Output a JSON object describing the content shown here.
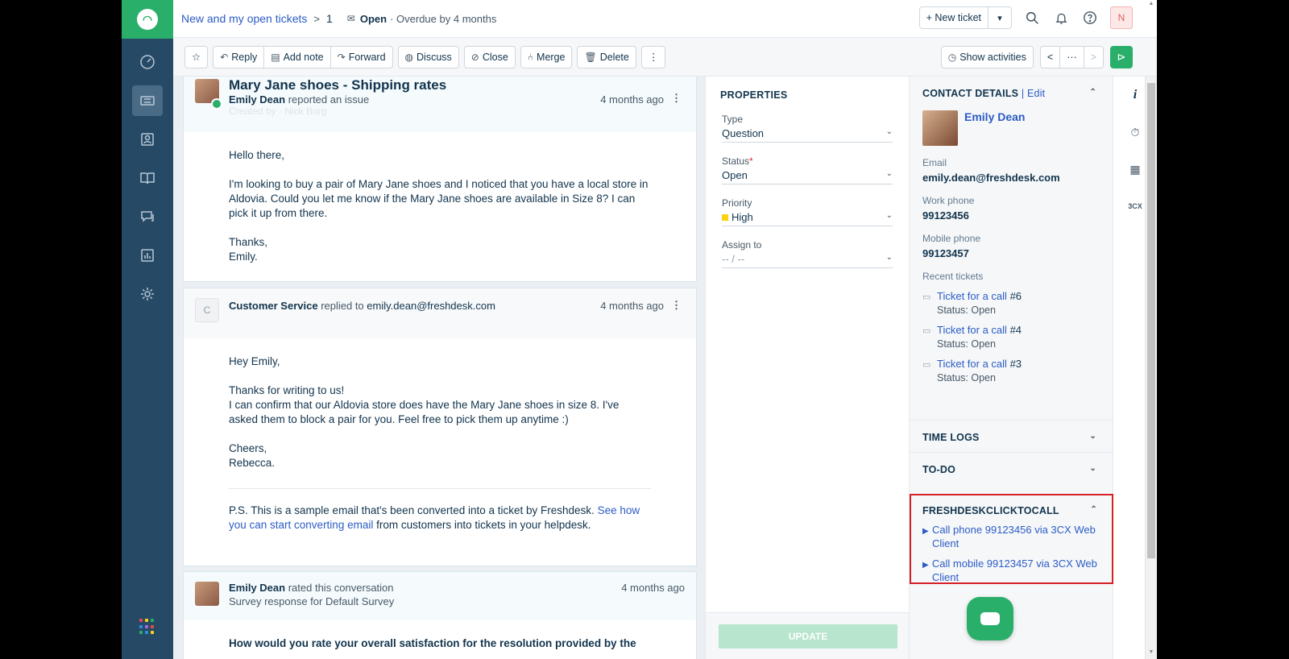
{
  "header": {
    "breadcrumb_link": "New and my open tickets",
    "breadcrumb_sep": ">",
    "ticket_number": "1",
    "status": "Open",
    "overdue": "· Overdue by 4 months",
    "new_ticket_label": "+ New ticket",
    "user_initial": "N"
  },
  "toolbar": {
    "reply": "Reply",
    "add_note": "Add note",
    "forward": "Forward",
    "discuss": "Discuss",
    "close": "Close",
    "merge": "Merge",
    "delete": "Delete",
    "more": "⋮",
    "show_activities": "Show activities",
    "prev": "<",
    "ellipsis": "···",
    "next": ">"
  },
  "ticket": {
    "subject": "Mary Jane shoes - Shipping rates",
    "reporter": "Emily Dean",
    "reported_text": "reported an issue",
    "created_by": "Created by - Nick Borg",
    "time": "4 months ago",
    "body": [
      "Hello there,",
      "I'm looking to buy a pair of Mary Jane shoes and I noticed that you have a local store in Aldovia. Could you let me know if the Mary Jane shoes are available in Size 8? I can pick it up from there."
    ],
    "signoff": "Thanks,",
    "signature": "Emily."
  },
  "reply": {
    "avatar_letter": "C",
    "author": "Customer Service",
    "replied_to": "replied to",
    "to": "emily.dean@freshdesk.com",
    "time": "4 months ago",
    "greeting": "Hey Emily,",
    "line1": "Thanks for writing to us!",
    "line2": "I can confirm that our Aldovia store does have the Mary Jane shoes in size 8. I've asked them to block a pair for you. Feel free to pick them up anytime :)",
    "signoff": "Cheers,",
    "signature": "Rebecca.",
    "ps_prefix": "P.S. This is a sample email that's been converted into a ticket by Freshdesk.",
    "ps_link": "See how you can start converting email",
    "ps_suffix": "from customers into tickets in your helpdesk."
  },
  "rating": {
    "author": "Emily Dean",
    "action": "rated this conversation",
    "survey": "Survey response for Default Survey",
    "time": "4 months ago",
    "question": "How would you rate your overall satisfaction for the resolution provided by the"
  },
  "properties": {
    "title": "PROPERTIES",
    "type_label": "Type",
    "type_value": "Question",
    "status_label": "Status",
    "required_mark": "*",
    "status_value": "Open",
    "priority_label": "Priority",
    "priority_value": "High",
    "priority_color": "#ffd012",
    "assign_label": "Assign to",
    "assign_value": "-- / --",
    "update": "UPDATE"
  },
  "contact": {
    "title": "CONTACT DETAILS",
    "edit": "| Edit",
    "name": "Emily Dean",
    "email_label": "Email",
    "email": "emily.dean@freshdesk.com",
    "work_label": "Work phone",
    "work": "99123456",
    "mobile_label": "Mobile phone",
    "mobile": "99123457",
    "recent_label": "Recent tickets",
    "recent": [
      {
        "title": "Ticket for a call",
        "num": "#6",
        "status": "Status: Open"
      },
      {
        "title": "Ticket for a call",
        "num": "#4",
        "status": "Status: Open"
      },
      {
        "title": "Ticket for a call",
        "num": "#3",
        "status": "Status: Open"
      }
    ],
    "time_logs": "TIME LOGS",
    "todo": "TO-DO",
    "c2c_title": "FRESHDESKCLICKTOCALL",
    "c2c_phone": "Call phone 99123456 via 3CX Web Client",
    "c2c_mobile": "Call mobile 99123457 via 3CX Web Client"
  },
  "rail": {
    "info": "i",
    "threecx": "3CX"
  },
  "colors": {
    "brand_green": "#2aaf6a",
    "nav_bg": "#264966",
    "link_blue": "#2c5cc5",
    "highlight_red": "#d71f26"
  }
}
